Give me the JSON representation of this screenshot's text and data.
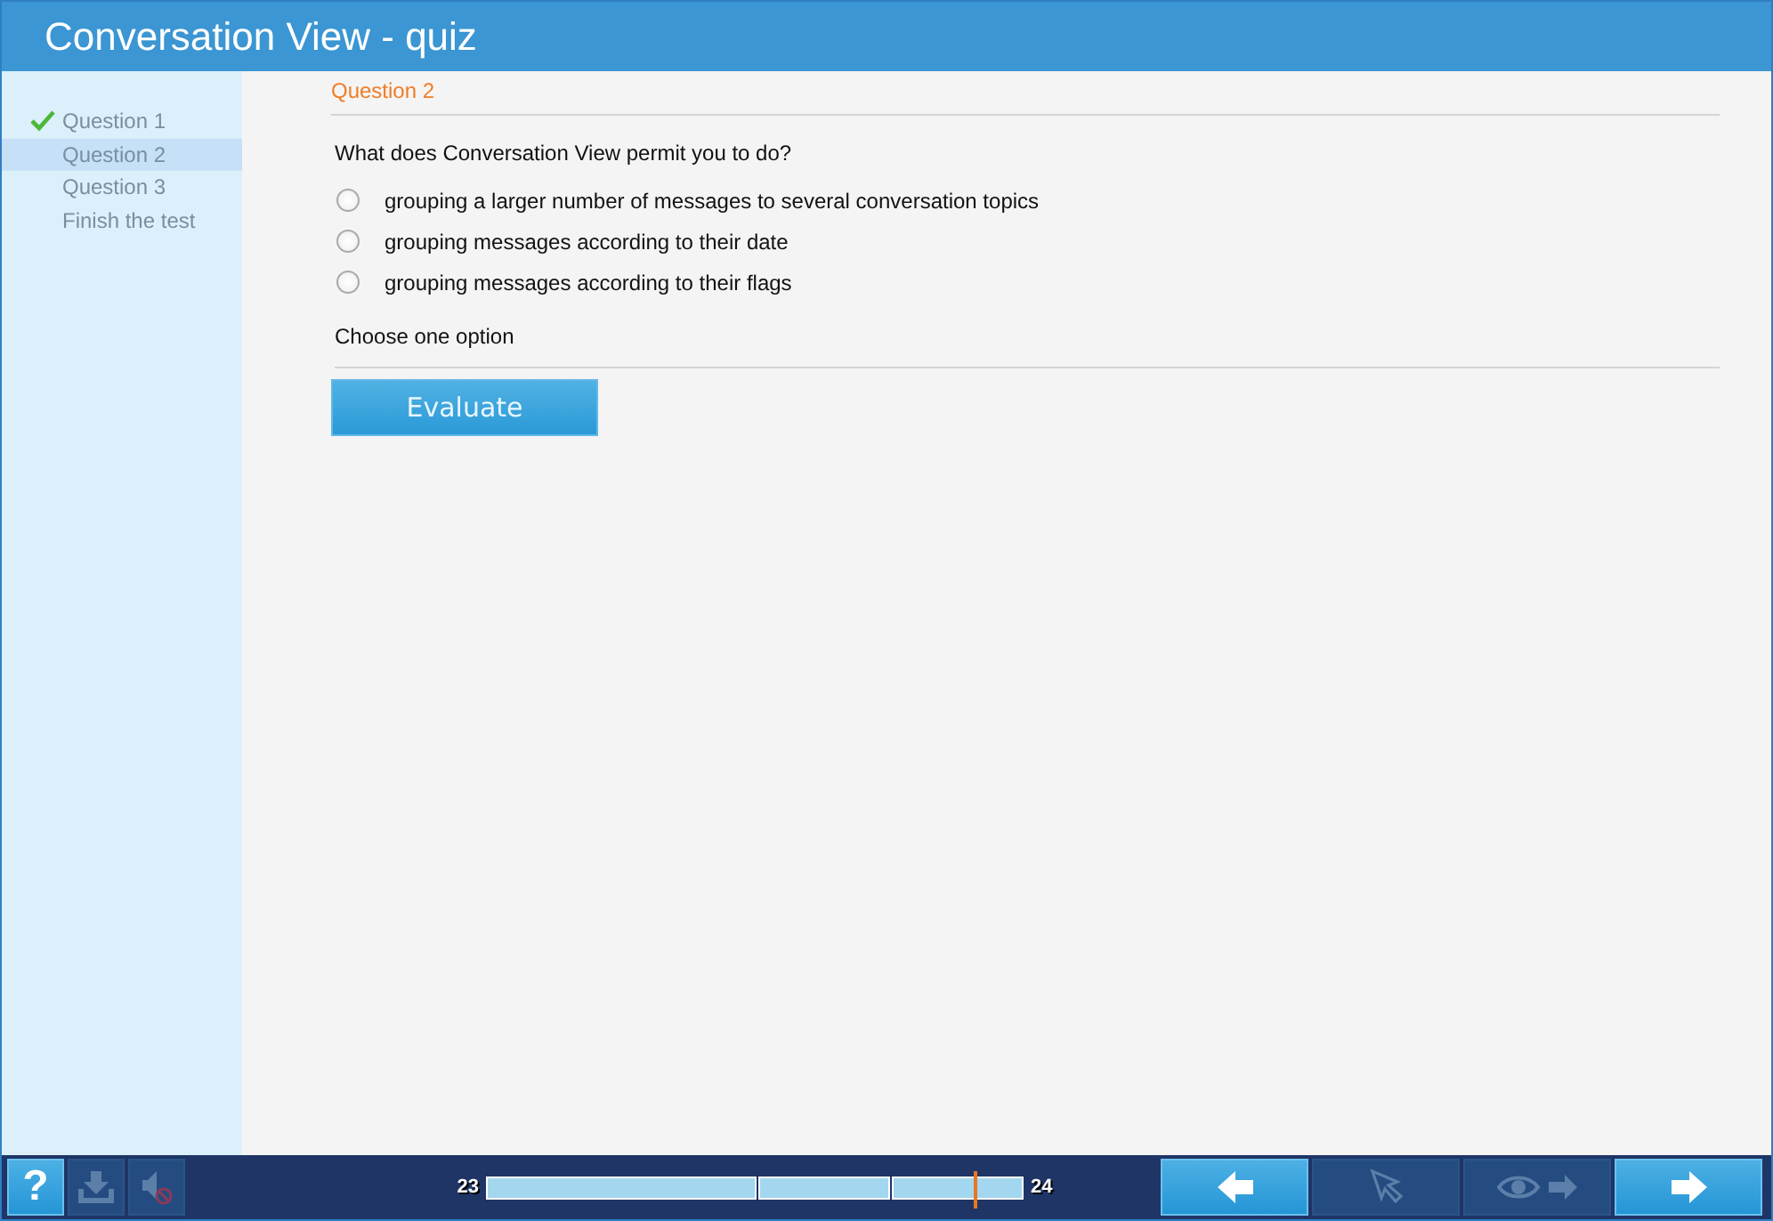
{
  "window": {
    "title": "Conversation View - quiz"
  },
  "sidebar": {
    "items": [
      {
        "label": "Question  1",
        "selected": false,
        "completed": true
      },
      {
        "label": "Question  2",
        "selected": true,
        "completed": false
      },
      {
        "label": "Question  3",
        "selected": false,
        "completed": false
      },
      {
        "label": "Finish the test",
        "selected": false,
        "completed": false
      }
    ]
  },
  "question": {
    "heading": "Question  2",
    "text": "What does Conversation View permit you to do?",
    "options": [
      {
        "label": "grouping a larger number of messages to several conversation topics",
        "selected": false
      },
      {
        "label": "grouping messages according to their date",
        "selected": false
      },
      {
        "label": "grouping messages according to their flags",
        "selected": false
      }
    ],
    "hint": "Choose one option",
    "button": "Evaluate"
  },
  "toolbar": {
    "left_buttons": [
      {
        "kind": "help",
        "label": "?",
        "disabled": false
      },
      {
        "kind": "download",
        "disabled": true
      },
      {
        "kind": "sound",
        "disabled": true
      }
    ],
    "progress": {
      "start": "23",
      "end": "24",
      "level": 0.91
    },
    "right_buttons": [
      {
        "kind": "back",
        "disabled": false
      },
      {
        "kind": "pointer",
        "disabled": true
      },
      {
        "kind": "show-next",
        "disabled": true
      },
      {
        "kind": "next",
        "disabled": false
      }
    ]
  }
}
